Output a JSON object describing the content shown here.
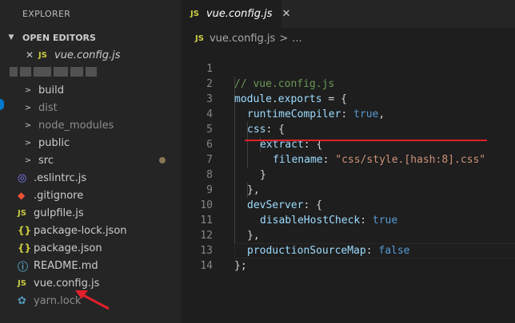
{
  "sidebar": {
    "title": "EXPLORER",
    "open_editors_header": "OPEN EDITORS",
    "open_editor": {
      "icon": "JS",
      "label": "vue.config.js"
    },
    "tree": [
      {
        "label": "build",
        "type": "folder"
      },
      {
        "label": "dist",
        "type": "folder"
      },
      {
        "label": "node_modules",
        "type": "folder"
      },
      {
        "label": "public",
        "type": "folder"
      },
      {
        "label": "src",
        "type": "folder"
      },
      {
        "label": ".eslintrc.js",
        "type": "eslint"
      },
      {
        "label": ".gitignore",
        "type": "git"
      },
      {
        "label": "gulpfile.js",
        "type": "js"
      },
      {
        "label": "package-lock.json",
        "type": "json"
      },
      {
        "label": "package.json",
        "type": "json"
      },
      {
        "label": "README.md",
        "type": "info"
      },
      {
        "label": "vue.config.js",
        "type": "js"
      },
      {
        "label": "yarn.lock",
        "type": "yarn"
      }
    ]
  },
  "tab": {
    "icon": "JS",
    "label": "vue.config.js",
    "close": "✕"
  },
  "breadcrumb": {
    "icon": "JS",
    "file": "vue.config.js",
    "separator": ">",
    "more": "..."
  },
  "code": {
    "line_numbers": [
      "1",
      "2",
      "3",
      "4",
      "5",
      "6",
      "7",
      "8",
      "9",
      "10",
      "11",
      "12",
      "13",
      "14"
    ],
    "l1": "// vue.config.js",
    "l2a": "module",
    "l2b": ".",
    "l2c": "exports",
    "l2d": " = {",
    "l3a": "runtimeCompiler",
    "l3b": ": ",
    "l3c": "true",
    "l3d": ",",
    "l4a": "css",
    "l4b": ": {",
    "l5a": "extract",
    "l5b": ": {",
    "l6a": "filename",
    "l6b": ": ",
    "l6c": "\"css/style.[hash:8].css\"",
    "l7": "}",
    "l8": "},",
    "l9a": "devServer",
    "l9b": ": {",
    "l10a": "disableHostCheck",
    "l10b": ": ",
    "l10c": "true",
    "l11": "},",
    "l12a": "productionSourceMap",
    "l12b": ": ",
    "l12c": "false",
    "l13": "};"
  },
  "colors": {
    "annotation_red": "#e0202a",
    "accent_blue": "#007acc"
  }
}
